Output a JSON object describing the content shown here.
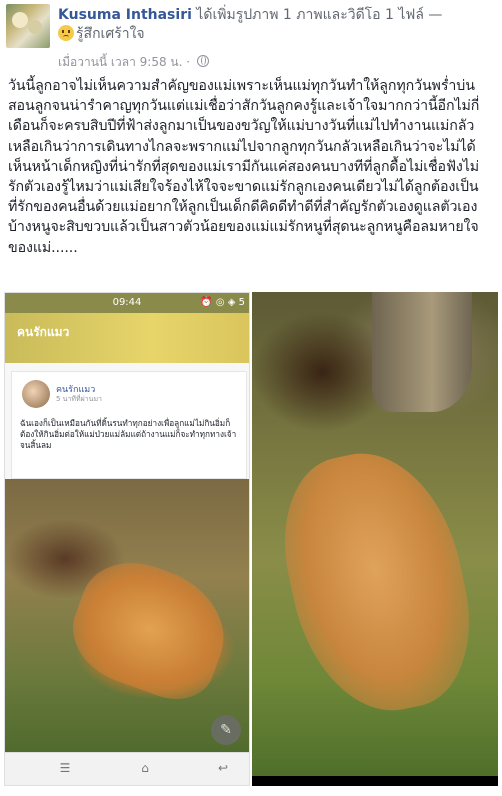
{
  "post": {
    "author": "Kusuma Inthasiri",
    "action": "ได้เพิ่มรูปภาพ 1 ภาพและวิดีโอ 1 ไฟล์ —",
    "feeling": "รู้สึกเศร้าใจ",
    "timestamp": "เมื่อวานนี้ เวลา 9:58 น. ·",
    "privacy_icon": "globe-icon",
    "body": "วันนี้ลูกอาจไม่เห็นความสำคัญของแม่เพราะเห็นแม่ทุกวันทำให้ลูกทุกวันพร่ำบ่นสอนลูกจนน่ารำคาญทุกวันแต่แม่เชื่อว่าสักวันลูกคงรู้และเจ้าใจมากกว่านี้อีกไม่กี่เดือนก็จะครบสิบปีที่ฟ้าส่งลูกมาเป็นของขวัญให้แม่บางวันที่แม่ไปทำงานแม่กลัวเหลือเกินว่าการเดินทางไกลจะพรากแม่ไปจากลูกทุกวันกลัวเหลือเกินว่าจะไม่ได้เห็นหน้าเด็กหญิงที่น่ารักที่สุดของแม่เรามีกันแค่สองคนบางทีที่ลูกดื้อไม่เชื่อฟังไม่รักตัวเองรู้ไหมว่าแม่เสียใจร้องไห้ใจจะขาดแม่รักลูกเองคนเดียวไม่ได้ลูกต้องเป็นที่รักของคนอื่นด้วยแม่อยากให้ลูกเป็นเด็กดีคิดดีทำดีที่สำคัญรักตัวเองดูแลตัวเองบ้างหนูจะสิบขวบแล้วเป็นสาวตัวน้อยของแม่แม่รักหนูที่สุดนะลูกหนูคือลมหายใจของแม่......"
  },
  "screenshot": {
    "status_time": "09:44",
    "status_right": "5",
    "app_title": "คนรักแมว",
    "shared_name": "คนรักแมว",
    "shared_sub": "5 นาทีที่ผ่านมา",
    "shared_text": "ฉันเองก็เป็นเหมือนกันที่ดิ้นรนทำทุกอย่างเพื่อลูกแม่ไม่กินอิ่มก็ต้องให้กินอิ่มต่อให้แม่ป่วยแม่ล้มแต่ถ้างานแม่ก็จะทำทุกทางเจ้าจนสิ้นลม",
    "nav_icons": [
      "menu-icon",
      "home-icon",
      "back-icon"
    ]
  },
  "colors": {
    "link": "#365899",
    "text": "#1d2129",
    "meta": "#90949c"
  }
}
